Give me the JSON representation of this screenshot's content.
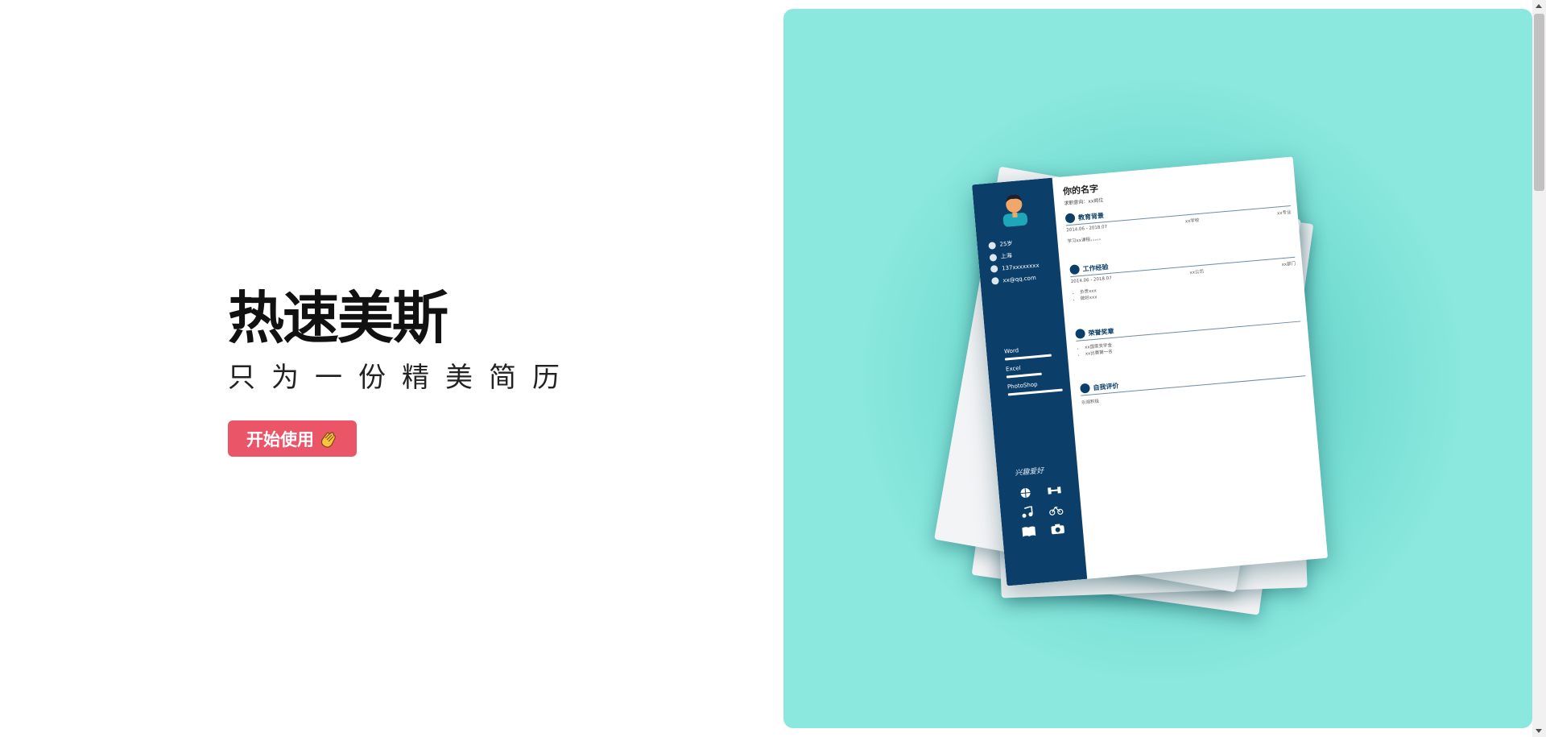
{
  "hero": {
    "title": "热速美斯",
    "subtitle": "只为一份精美简历",
    "start_button": "开始使用"
  },
  "resume": {
    "name": "你的名字",
    "intent": "求职意向：xx岗位",
    "contacts": [
      {
        "icon": "person-icon",
        "text": "25岁"
      },
      {
        "icon": "location-icon",
        "text": "上海"
      },
      {
        "icon": "phone-icon",
        "text": "137xxxxxxxx"
      },
      {
        "icon": "mail-icon",
        "text": "xx@qq.com"
      }
    ],
    "skills": [
      {
        "label": "Word",
        "level": 0.85
      },
      {
        "label": "Excel",
        "level": 0.65
      },
      {
        "label": "PhotoShop",
        "level": 1.0
      }
    ],
    "hobby_title": "兴趣爱好",
    "hobbies": [
      "basketball-icon",
      "dumbbell-icon",
      "music-icon",
      "bicycle-icon",
      "book-icon",
      "camera-icon"
    ],
    "sections": {
      "education": {
        "title": "教育背景",
        "date": "2014.06 - 2018.07",
        "school": "xx学校",
        "major": "xx专业",
        "detail": "学习xx课程。。。。。"
      },
      "work": {
        "title": "工作经验",
        "date": "2014.06 - 2018.07",
        "company": "xx公司",
        "dept": "xx部门",
        "items": [
          "负责xxx",
          "做好xxx"
        ]
      },
      "honors": {
        "title": "荣誉奖章",
        "items": [
          "xx国家奖学金",
          "xx比赛第一名"
        ]
      },
      "self": {
        "title": "自我评价",
        "text": "乐观积极"
      }
    }
  },
  "colors": {
    "button": "#ea5568",
    "panel": "#8ae8de",
    "resume_sidebar": "#0b3f6a"
  }
}
